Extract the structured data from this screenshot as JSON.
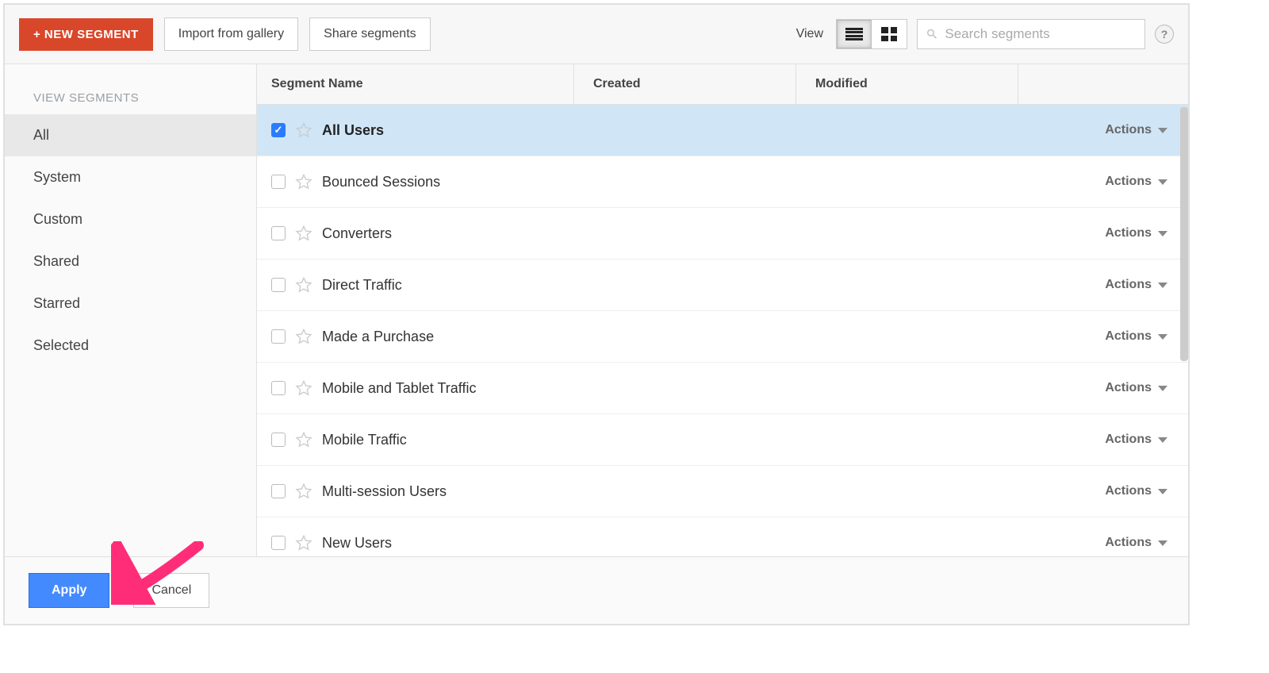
{
  "toolbar": {
    "new_segment": "+ NEW SEGMENT",
    "import_gallery": "Import from gallery",
    "share_segments": "Share segments",
    "view_label": "View",
    "search_placeholder": "Search segments",
    "help_label": "?"
  },
  "sidebar": {
    "heading": "VIEW SEGMENTS",
    "items": [
      {
        "label": "All",
        "active": true
      },
      {
        "label": "System",
        "active": false
      },
      {
        "label": "Custom",
        "active": false
      },
      {
        "label": "Shared",
        "active": false
      },
      {
        "label": "Starred",
        "active": false
      },
      {
        "label": "Selected",
        "active": false
      }
    ]
  },
  "table": {
    "headers": {
      "name": "Segment Name",
      "created": "Created",
      "modified": "Modified"
    },
    "action_label": "Actions",
    "rows": [
      {
        "name": "All Users",
        "checked": true
      },
      {
        "name": "Bounced Sessions",
        "checked": false
      },
      {
        "name": "Converters",
        "checked": false
      },
      {
        "name": "Direct Traffic",
        "checked": false
      },
      {
        "name": "Made a Purchase",
        "checked": false
      },
      {
        "name": "Mobile and Tablet Traffic",
        "checked": false
      },
      {
        "name": "Mobile Traffic",
        "checked": false
      },
      {
        "name": "Multi-session Users",
        "checked": false
      },
      {
        "name": "New Users",
        "checked": false
      }
    ]
  },
  "footer": {
    "apply": "Apply",
    "cancel": "Cancel"
  }
}
